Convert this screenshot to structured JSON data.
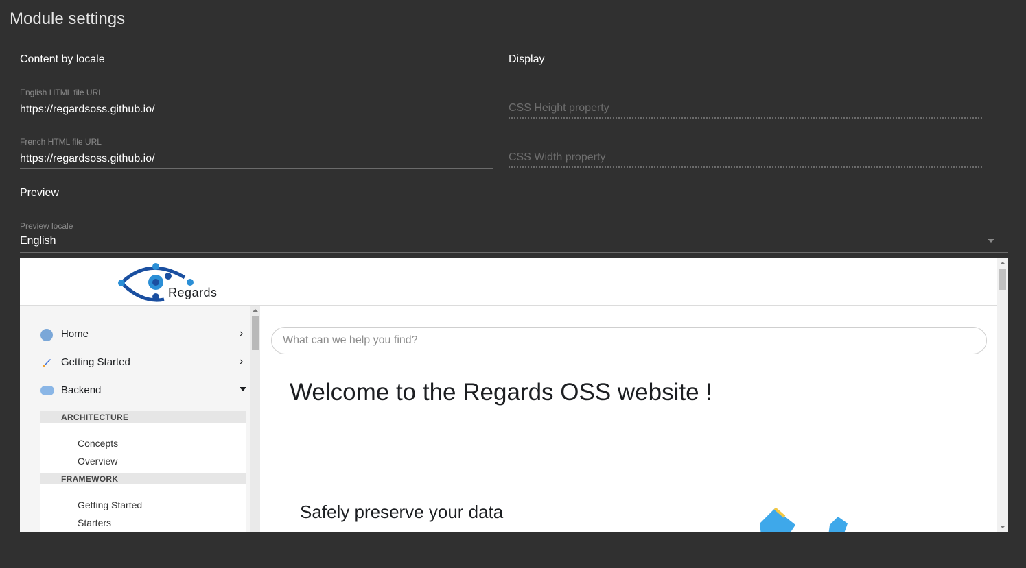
{
  "page_title": "Module settings",
  "content_section": {
    "title": "Content by locale",
    "english_label": "English HTML file URL",
    "english_value": "https://regardsoss.github.io/",
    "french_label": "French HTML file URL",
    "french_value": "https://regardsoss.github.io/"
  },
  "display_section": {
    "title": "Display",
    "height_placeholder": "CSS Height property",
    "width_placeholder": "CSS Width property"
  },
  "preview_section": {
    "title": "Preview",
    "locale_label": "Preview locale",
    "locale_value": "English"
  },
  "preview_site": {
    "logo_text": "Regards",
    "search_placeholder": "What can we help you find?",
    "welcome_heading": "Welcome to the Regards OSS website !",
    "subheading": "Safely preserve your data",
    "nav": [
      {
        "label": "Home",
        "icon": "globe-icon",
        "expanded": false
      },
      {
        "label": "Getting Started",
        "icon": "rocket-icon",
        "expanded": false
      },
      {
        "label": "Backend",
        "icon": "cloud-code-icon",
        "expanded": true
      }
    ],
    "categories": [
      {
        "label": "ARCHITECTURE",
        "items": [
          "Concepts",
          "Overview"
        ]
      },
      {
        "label": "FRAMEWORK",
        "items": [
          "Getting Started",
          "Starters"
        ]
      }
    ]
  },
  "colors": {
    "background": "#303030",
    "logo_blue": "#1a4fa0",
    "logo_cyan": "#2b8fd6"
  }
}
